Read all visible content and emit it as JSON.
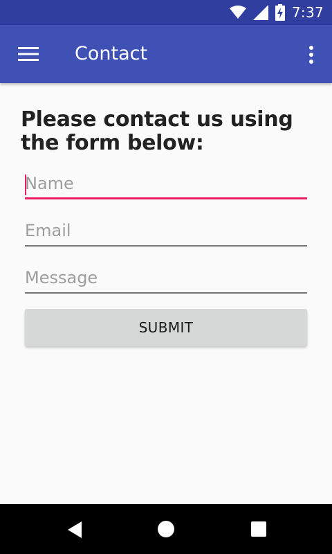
{
  "status_bar": {
    "time": "7:37",
    "icons": [
      "wifi-icon",
      "cell-signal-icon",
      "battery-charging-icon"
    ]
  },
  "app_bar": {
    "title": "Contact",
    "icons": [
      "menu-icon",
      "overflow-menu-icon"
    ]
  },
  "form": {
    "heading": "Please contact us using the form below:",
    "name_placeholder": "Name",
    "email_placeholder": "Email",
    "message_placeholder": "Message",
    "submit_label": "SUBMIT"
  },
  "nav_bar": {
    "icons": [
      "back-icon",
      "home-icon",
      "recents-icon"
    ]
  },
  "colors": {
    "status_bar": "#303f9f",
    "app_bar": "#3f51b5",
    "accent": "#e91e63",
    "button": "#d6d7d7"
  }
}
